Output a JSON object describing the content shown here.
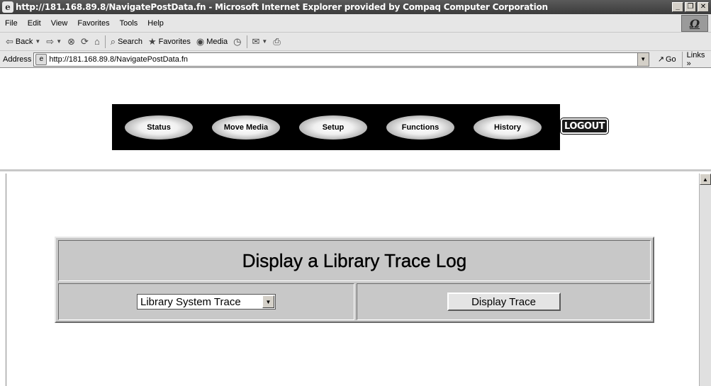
{
  "window": {
    "title": "http://181.168.89.8/NavigatePostData.fn - Microsoft Internet Explorer provided by Compaq Computer Corporation",
    "buttons": [
      "_",
      "▫",
      "×"
    ]
  },
  "menubar": {
    "items": [
      "File",
      "Edit",
      "View",
      "Favorites",
      "Tools",
      "Help"
    ]
  },
  "toolbar": {
    "back": "Back",
    "search": "Search",
    "favorites": "Favorites",
    "media": "Media"
  },
  "addressbar": {
    "label": "Address",
    "url": "http://181.168.89.8/NavigatePostData.fn",
    "go": "Go",
    "links": "Links »"
  },
  "nav": {
    "buttons": [
      "Status",
      "Move Media",
      "Setup",
      "Functions",
      "History"
    ],
    "logout": "LOGOUT"
  },
  "trace": {
    "heading": "Display a Library Trace Log",
    "select_value": "Library System Trace",
    "button_label": "Display Trace"
  }
}
